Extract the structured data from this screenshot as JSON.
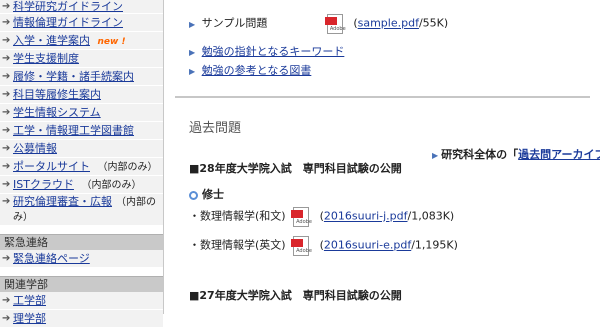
{
  "sidebar": {
    "items": [
      {
        "label": "科学研究ガイドライン"
      },
      {
        "label": "情報倫理ガイドライン"
      },
      {
        "label": "入学・進学案内",
        "badge": "new !"
      },
      {
        "label": "学生支援制度"
      },
      {
        "label": "履修・学籍・諸手続案内"
      },
      {
        "label": "科目等履修生案内"
      },
      {
        "label": "学生情報システム"
      },
      {
        "label": "工学・情報理工学図書館"
      },
      {
        "label": "公募情報"
      },
      {
        "label": "ポータルサイト",
        "note": "（内部のみ）"
      },
      {
        "label": "ISTクラウド",
        "note": "（内部のみ）"
      },
      {
        "label": "研究倫理審査・広報",
        "note": "（内部のみ）"
      }
    ],
    "emergency_header": "緊急連絡",
    "emergency_items": [
      {
        "label": "緊急連絡ページ"
      }
    ],
    "related_header": "関連学部",
    "related_items": [
      {
        "label": "工学部"
      },
      {
        "label": "理学部"
      }
    ]
  },
  "main": {
    "sample_label": "サンプル問題",
    "sample_link": "sample.pdf",
    "sample_size": "/55K)",
    "link_keyword": "勉強の指針となるキーワード",
    "link_books": "勉強の参考となる図書",
    "section_title": "過去問題",
    "archive_prefix": "研究科全体の",
    "archive_link": "過去問アーカイブ",
    "archive_open": "「",
    "archive_close": "」",
    "heading_2016": "■28年度大学院入試　専門科目試験の公開",
    "master_label": "修士",
    "files": [
      {
        "label": "・数理情報学(和文)",
        "link": "2016suuri-j.pdf",
        "size": "/1,083K)"
      },
      {
        "label": "・数理情報学(英文)",
        "link": "2016suuri-e.pdf",
        "size": "/1,195K)"
      }
    ],
    "heading_2015": "■27年度大学院入試　専門科目試験の公開"
  },
  "icons": {
    "pdf": "pdf-icon",
    "arrow": "arrow-right-icon"
  },
  "colors": {
    "link": "#1a3a9a",
    "new": "#ff6600",
    "pdf_red": "#d9252b"
  }
}
